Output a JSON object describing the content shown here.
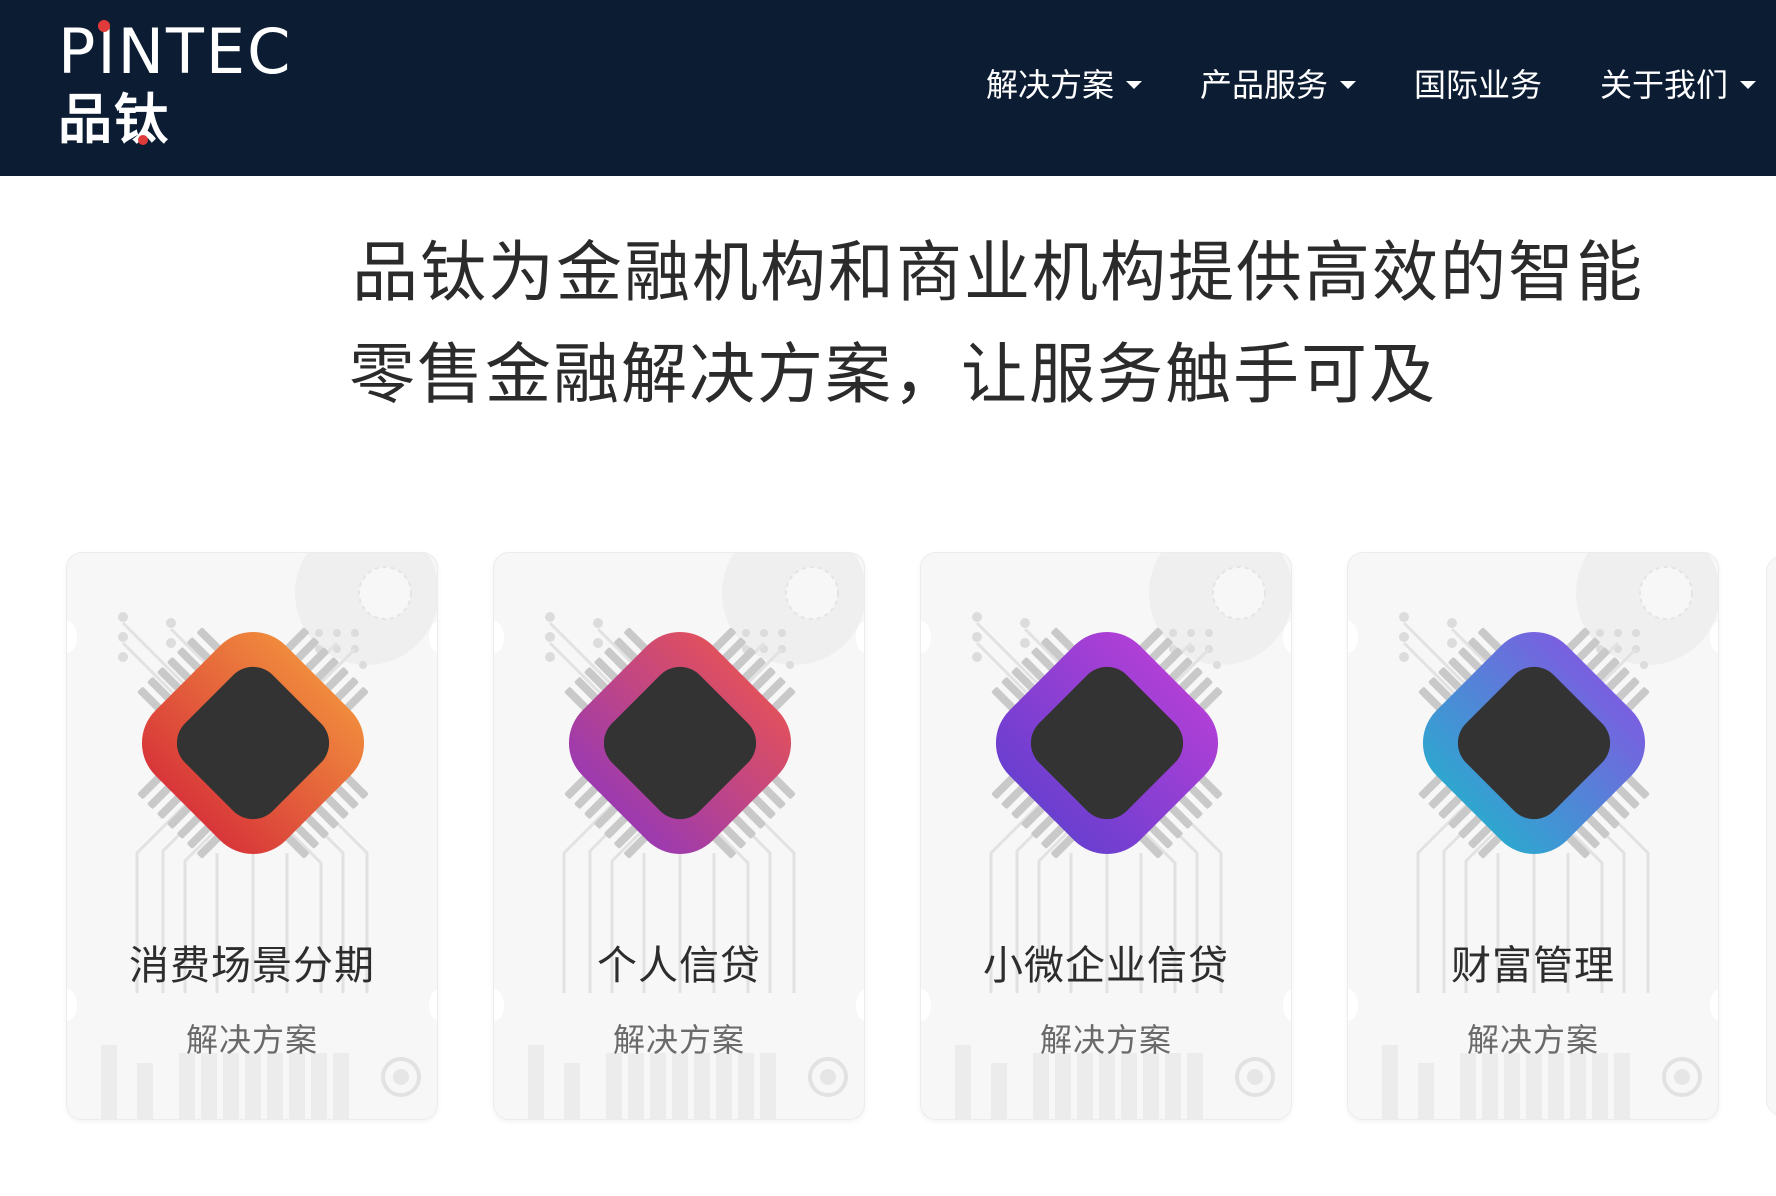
{
  "header": {
    "logo_en": "PINTEC",
    "logo_cn": "品钛",
    "brand_color": "#e03b3b",
    "background": "#0c1d33"
  },
  "nav": [
    {
      "label": "解决方案",
      "has_dropdown": true
    },
    {
      "label": "产品服务",
      "has_dropdown": true
    },
    {
      "label": "国际业务",
      "has_dropdown": false
    },
    {
      "label": "关于我们",
      "has_dropdown": true
    }
  ],
  "headline": {
    "line1": "品钛为金融机构和商业机构提供高效的智能",
    "line2": "零售金融解决方案，让服务触手可及"
  },
  "cards": [
    {
      "title": "消费场景分期",
      "subtitle": "解决方案",
      "icon": "chip-icon",
      "gradient": [
        "#f08a3c",
        "#d8363a"
      ]
    },
    {
      "title": "个人信贷",
      "subtitle": "解决方案",
      "icon": "chip-icon",
      "gradient": [
        "#e0505e",
        "#9c3ab0"
      ]
    },
    {
      "title": "小微企业信贷",
      "subtitle": "解决方案",
      "icon": "chip-icon",
      "gradient": [
        "#b03fd6",
        "#6a3fd0"
      ]
    },
    {
      "title": "财富管理",
      "subtitle": "解决方案",
      "icon": "chip-icon",
      "gradient": [
        "#7a5fe0",
        "#2fa6d0"
      ]
    }
  ]
}
